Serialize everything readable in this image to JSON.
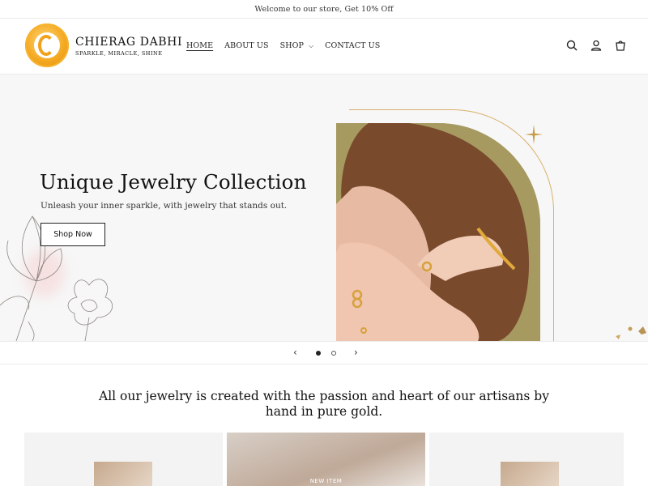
{
  "announcement": "Welcome to our store, Get 10% Off",
  "brand": {
    "name": "CHIERAG DABHI",
    "tagline": "SPARKLE, MIRACLE, SHINE"
  },
  "nav": [
    {
      "label": "HOME",
      "active": true
    },
    {
      "label": "ABOUT US"
    },
    {
      "label": "SHOP",
      "has_dropdown": true
    },
    {
      "label": "CONTACT US"
    }
  ],
  "header_icons": [
    "search-icon",
    "account-icon",
    "cart-icon"
  ],
  "hero": {
    "title": "Unique Jewelry Collection",
    "subtitle": "Unleash your inner sparkle, with jewelry that stands out.",
    "button_label": "Shop Now"
  },
  "slider": {
    "total_slides": 2,
    "current_slide": 1
  },
  "tagline": "All our jewelry is created with the passion and heart of our artisans by hand in pure gold.",
  "featured": {
    "center_label": "NEW ITEM"
  },
  "colors": {
    "accent_gold": "#d8b06a",
    "logo_gold": "#f4a922"
  }
}
